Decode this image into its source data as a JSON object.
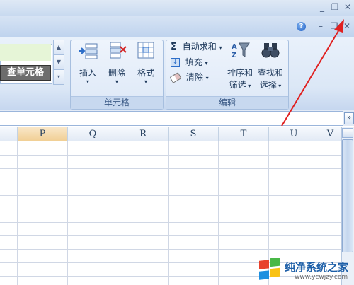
{
  "ribbon": {
    "cell_style_label": "查单元格",
    "groups": {
      "cells": {
        "label": "单元格",
        "insert": "插入",
        "delete": "删除",
        "format": "格式"
      },
      "editing": {
        "label": "编辑",
        "autosum": "自动求和",
        "fill": "填充",
        "clear": "清除",
        "sort_filter_line1": "排序和",
        "sort_filter_line2": "筛选",
        "find_select_line1": "查找和",
        "find_select_line2": "选择"
      }
    }
  },
  "titlebar": {
    "minimize": "_",
    "restore": "❐",
    "close": "✕"
  },
  "workbook_controls": {
    "help": "?",
    "minimize": "–",
    "restore": "❐",
    "close": "✕"
  },
  "formula_bar": {
    "expand_glyph": "»"
  },
  "sheet": {
    "columns": [
      "P",
      "Q",
      "R",
      "S",
      "T",
      "U",
      "V"
    ]
  },
  "watermark": {
    "title": "纯净系统之家",
    "url": "www.ycwjzy.com"
  },
  "annotation": {
    "arrow_color": "#e02020"
  }
}
